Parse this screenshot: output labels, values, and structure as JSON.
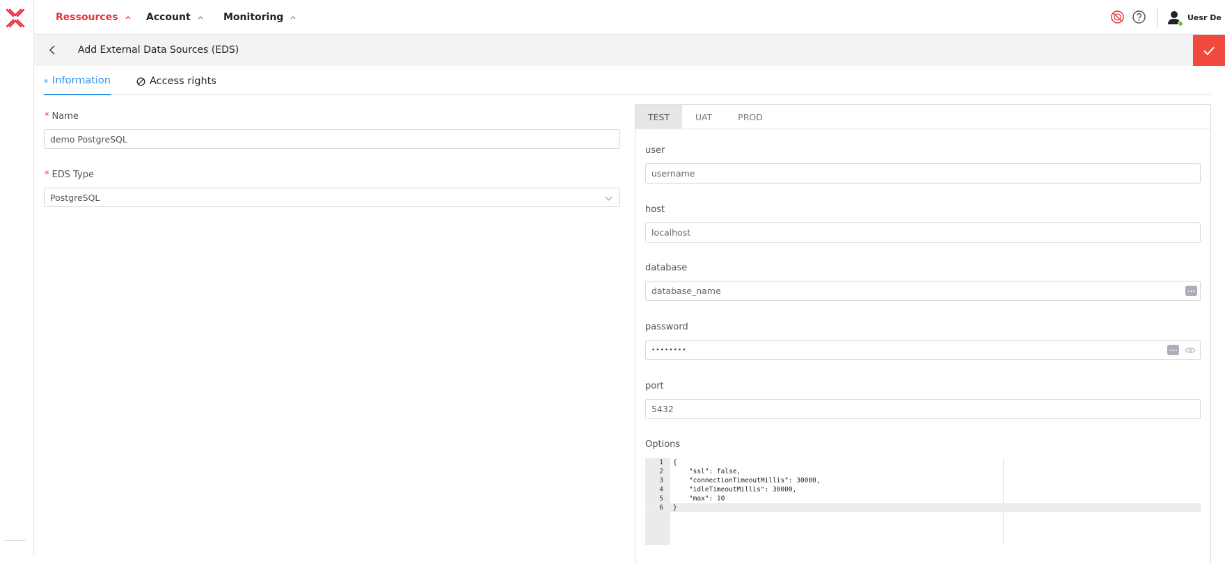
{
  "nav": {
    "items": [
      {
        "label": "Ressources",
        "active": true
      },
      {
        "label": "Account",
        "active": false
      },
      {
        "label": "Monitoring",
        "active": false
      }
    ],
    "user_name": "Uesr De",
    "icons": [
      "no-access-icon",
      "help-icon",
      "user-icon"
    ]
  },
  "subheader": {
    "title": "Add External Data Sources (EDS)"
  },
  "tabs": [
    {
      "label": "Information",
      "icon": "gear-icon",
      "active": true
    },
    {
      "label": "Access rights",
      "icon": "ban-icon",
      "active": false
    }
  ],
  "form": {
    "name_label": "Name",
    "name_value": "demo PostgreSQL",
    "eds_type_label": "EDS Type",
    "eds_type_value": "PostgreSQL",
    "required_mark": "*"
  },
  "env_tabs": [
    {
      "label": "TEST",
      "active": true
    },
    {
      "label": "UAT",
      "active": false
    },
    {
      "label": "PROD",
      "active": false
    }
  ],
  "connection": {
    "user_label": "user",
    "user_value": "username",
    "host_label": "host",
    "host_value": "localhost",
    "database_label": "database",
    "database_value": "database_name",
    "password_label": "password",
    "password_value": "••••••••",
    "port_label": "port",
    "port_value": "5432",
    "options_label": "Options"
  },
  "options_code": {
    "line_numbers": [
      "1",
      "2",
      "3",
      "4",
      "5",
      "6"
    ],
    "lines": [
      "{",
      "    \"ssl\": false,",
      "    \"connectionTimeoutMillis\": 30000,",
      "    \"idleTimeoutMillis\": 30000,",
      "    \"max\": 10",
      "}"
    ],
    "active_line": 6
  },
  "colors": {
    "brand": "#e8313b",
    "confirm": "#f04a3f",
    "tab_active": "#2f8fe6",
    "presence": "#7bbf2e"
  }
}
